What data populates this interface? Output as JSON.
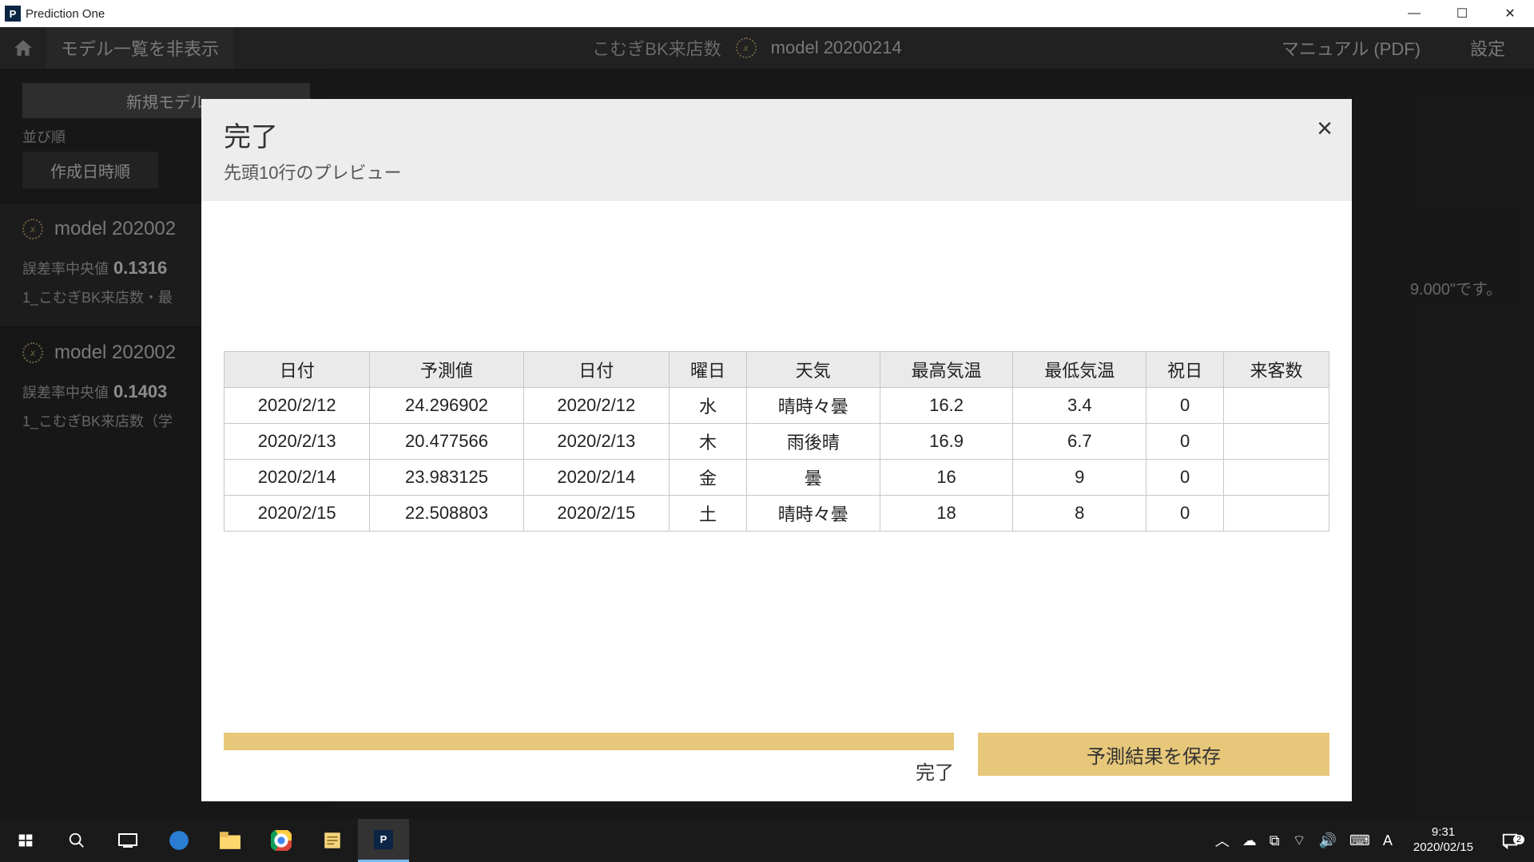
{
  "window": {
    "app_icon_letter": "P",
    "title": "Prediction One"
  },
  "topbar": {
    "hide_models": "モデル一覧を非表示",
    "project": "こむぎBK来店数",
    "model": "model 20200214",
    "manual": "マニュアル (PDF)",
    "settings": "設定"
  },
  "sidebar": {
    "new_model": "新規モデル",
    "sort_label": "並び順",
    "sort_value": "作成日時順",
    "models": [
      {
        "name": "model 202002",
        "err_label": "誤差率中央値",
        "err_value": "0.1316",
        "file": "1_こむぎBK来店数・最"
      },
      {
        "name": "model 202002",
        "err_label": "誤差率中央値",
        "err_value": "0.1403",
        "file": "1_こむぎBK来店数（学"
      }
    ]
  },
  "main_note": "9.000\"です。",
  "modal": {
    "title": "完了",
    "subtitle": "先頭10行のプレビュー",
    "close": "×",
    "headers": [
      "日付",
      "予測値",
      "日付",
      "曜日",
      "天気",
      "最高気温",
      "最低気温",
      "祝日",
      "来客数"
    ],
    "rows": [
      [
        "2020/2/12",
        "24.296902",
        "2020/2/12",
        "水",
        "晴時々曇",
        "16.2",
        "3.4",
        "0",
        ""
      ],
      [
        "2020/2/13",
        "20.477566",
        "2020/2/13",
        "木",
        "雨後晴",
        "16.9",
        "6.7",
        "0",
        ""
      ],
      [
        "2020/2/14",
        "23.983125",
        "2020/2/14",
        "金",
        "曇",
        "16",
        "9",
        "0",
        ""
      ],
      [
        "2020/2/15",
        "22.508803",
        "2020/2/15",
        "土",
        "晴時々曇",
        "18",
        "8",
        "0",
        ""
      ]
    ],
    "progress_label": "完了",
    "save_button": "予測結果を保存"
  },
  "taskbar": {
    "time": "9:31",
    "date": "2020/02/15",
    "ime": "A",
    "notif_count": "2"
  }
}
